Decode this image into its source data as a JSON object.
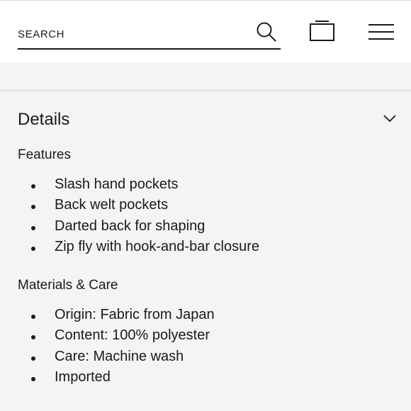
{
  "header": {
    "search_placeholder": "SEARCH",
    "search_icon": "search-icon",
    "bag_icon": "shopping-bag-icon",
    "menu_icon": "hamburger-menu-icon"
  },
  "details": {
    "title": "Details",
    "toggle_icon": "chevron-down-icon"
  },
  "features": {
    "title": "Features",
    "items": [
      "Slash hand pockets",
      "Back welt pockets",
      "Darted back for shaping",
      "Zip fly with hook-and-bar closure"
    ]
  },
  "materials": {
    "title": "Materials & Care",
    "items": [
      "Origin: Fabric from Japan",
      "Content: 100% polyester",
      "Care: Machine wash",
      "Imported"
    ]
  }
}
